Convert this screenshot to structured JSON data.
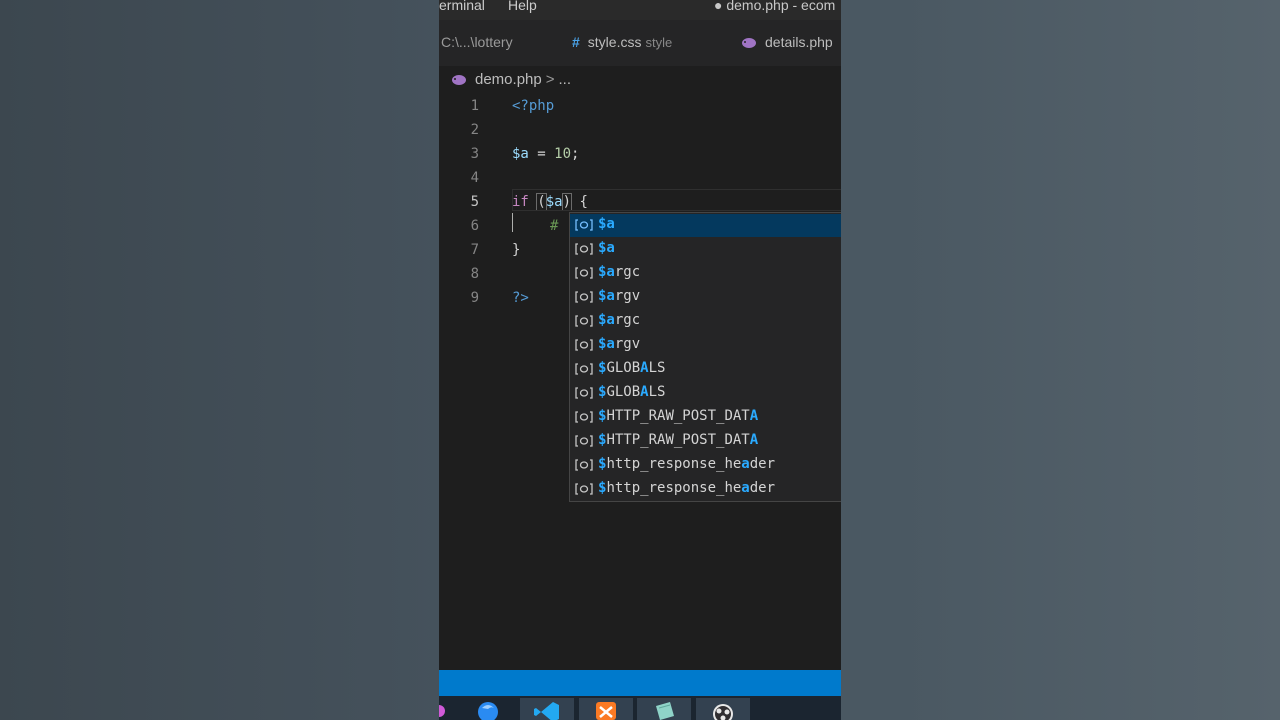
{
  "menubar": {
    "items": [
      "erminal",
      "Help"
    ],
    "window_title": "● demo.php - ecom"
  },
  "tabs": [
    {
      "label": "C:\\...\\lottery"
    },
    {
      "label": "style.css",
      "description": "style",
      "icon": "hash-icon"
    },
    {
      "label": "details.php",
      "icon": "php-elephant-icon"
    }
  ],
  "breadcrumb": {
    "file": "demo.php",
    "separator": ">",
    "rest": "..."
  },
  "editor": {
    "line_numbers": [
      "1",
      "2",
      "3",
      "4",
      "5",
      "6",
      "7",
      "8",
      "9"
    ],
    "active_line": "5",
    "lines": {
      "l1": {
        "tag": "<?php"
      },
      "l3": {
        "var": "$a",
        "op": " = ",
        "num": "10",
        "end": ";"
      },
      "l5": {
        "kw": "if",
        "sp": " ",
        "open": "(",
        "var": "$a",
        "close": ")",
        "brace": " {"
      },
      "l6": {
        "comment": "#"
      },
      "l7": {
        "brace": "}"
      },
      "l9": {
        "tag": "?>"
      }
    }
  },
  "suggestions": {
    "icon": "variable-icon",
    "items": [
      {
        "match": "$a",
        "rest": "",
        "selected": true
      },
      {
        "match": "$a",
        "rest": ""
      },
      {
        "match": "$a",
        "rest": "rgc"
      },
      {
        "match": "$a",
        "rest": "rgv"
      },
      {
        "match": "$a",
        "rest": "rgc"
      },
      {
        "match": "$a",
        "rest": "rgv"
      },
      {
        "pre": "$",
        "mid": "GLOB",
        "hl2": "A",
        "post": "LS"
      },
      {
        "pre": "$",
        "mid": "GLOB",
        "hl2": "A",
        "post": "LS"
      },
      {
        "pre": "$",
        "mid": "HTTP_RAW_POST_DAT",
        "hl2": "A",
        "post": ""
      },
      {
        "pre": "$",
        "mid": "HTTP_RAW_POST_DAT",
        "hl2": "A",
        "post": ""
      },
      {
        "pre": "$",
        "mid": "http_response_he",
        "hl2": "a",
        "post": "der"
      },
      {
        "pre": "$",
        "mid": "http_response_he",
        "hl2": "a",
        "post": "der"
      }
    ]
  },
  "colors": {
    "editor_bg": "#1e1e1e",
    "status_bar": "#007acc",
    "suggest_selected": "#04395e",
    "match_highlight": "#2aaaff"
  }
}
